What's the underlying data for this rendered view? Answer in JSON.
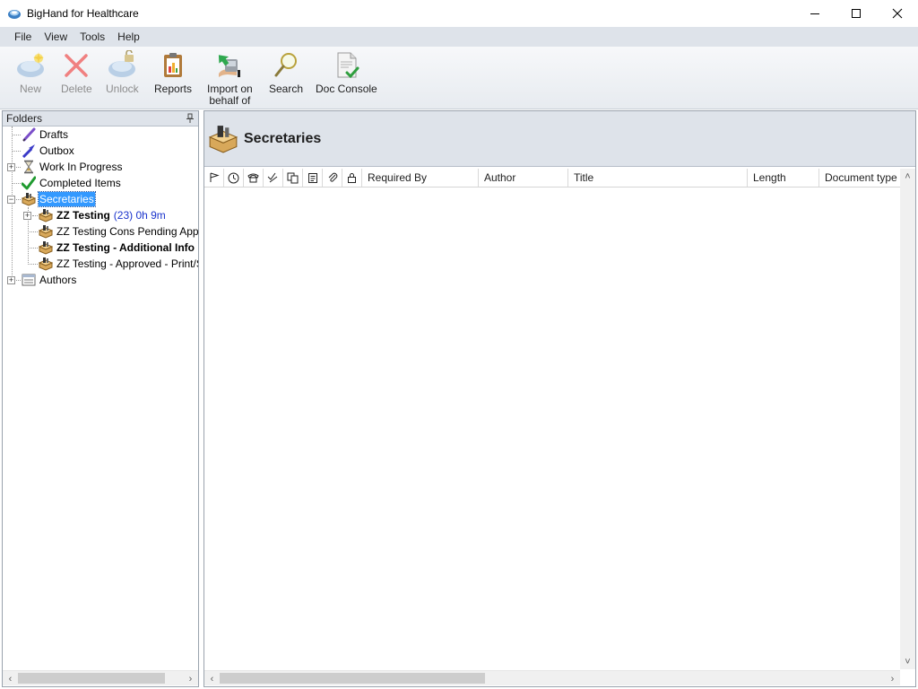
{
  "window": {
    "title": "BigHand for Healthcare",
    "controls": [
      "minimize",
      "maximize",
      "close"
    ]
  },
  "menu": [
    {
      "label": "File"
    },
    {
      "label": "View"
    },
    {
      "label": "Tools"
    },
    {
      "label": "Help"
    }
  ],
  "toolbar": {
    "new_label": "New",
    "delete_label": "Delete",
    "unlock_label": "Unlock",
    "reports_label": "Reports",
    "import_label_line1": "Import on",
    "import_label_line2": "behalf of",
    "search_label": "Search",
    "doc_console_label": "Doc Console"
  },
  "folders": {
    "header": "Folders",
    "items": [
      {
        "label": "Drafts",
        "icon": "pen-icon"
      },
      {
        "label": "Outbox",
        "icon": "outbox-arrow-icon"
      },
      {
        "label": "Work In Progress",
        "icon": "hourglass-icon"
      },
      {
        "label": "Completed Items",
        "icon": "check-icon"
      },
      {
        "label": "Secretaries",
        "icon": "secretaries-box-icon",
        "selected": true
      },
      {
        "label": "ZZ Testing",
        "count": "(23) 0h 9m",
        "bold": true
      },
      {
        "label": "ZZ Testing Cons Pending Approval"
      },
      {
        "label": "ZZ Testing - Additional Info Required",
        "bold": true
      },
      {
        "label": "ZZ Testing - Approved - Print/Send"
      },
      {
        "label": "Authors",
        "icon": "list-icon"
      }
    ]
  },
  "main": {
    "title": "Secretaries",
    "columns": [
      "Required By",
      "Author",
      "Title",
      "Length",
      "Document type"
    ],
    "icon_columns": [
      "flag-icon",
      "clock-icon",
      "phone-icon",
      "status-icon",
      "copy-icon",
      "notes-icon",
      "attachment-icon",
      "lock-icon"
    ]
  },
  "colors": {
    "menu_bg": "#dee3ea",
    "selection": "#3399ff",
    "count_text": "#1a33cc"
  }
}
